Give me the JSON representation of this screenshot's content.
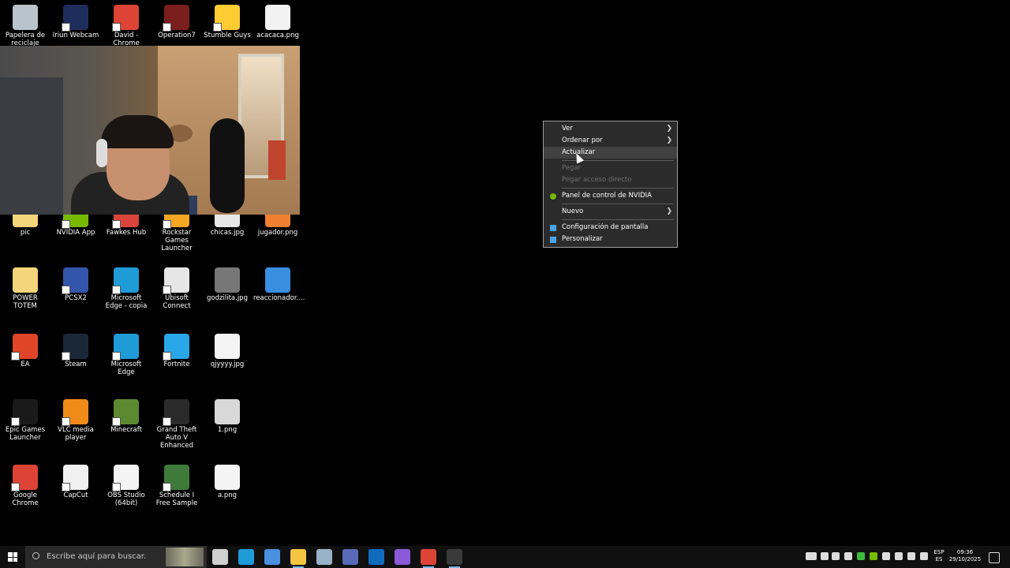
{
  "desktop": {
    "icons": [
      {
        "label": "Papelera de reciclaje",
        "icon": "recycle-bin-icon",
        "color": "#b9c3cc"
      },
      {
        "label": "Iriun Webcam",
        "icon": "iriun-webcam-icon",
        "color": "#1f2d5c"
      },
      {
        "label": "David - Chrome",
        "icon": "chrome-icon",
        "color": "#dd4436"
      },
      {
        "label": "Operation7",
        "icon": "operation7-icon",
        "color": "#7a1e1e"
      },
      {
        "label": "Stumble Guys",
        "icon": "stumble-guys-icon",
        "color": "#ffcc33"
      },
      {
        "label": "acacaca.png",
        "icon": "image-file-icon",
        "color": "#f2f2f2"
      },
      {
        "label": "pic",
        "icon": "folder-icon",
        "color": "#f4d57a"
      },
      {
        "label": "NVIDIA App",
        "icon": "nvidia-icon",
        "color": "#76b900"
      },
      {
        "label": "Fawkes Hub",
        "icon": "fawkes-hub-icon",
        "color": "#d9453a"
      },
      {
        "label": "Rockstar Games Launcher",
        "icon": "rockstar-icon",
        "color": "#f5a623"
      },
      {
        "label": "chicas.jpg",
        "icon": "image-file-icon",
        "color": "#e8e8e8"
      },
      {
        "label": "jugador.png",
        "icon": "image-file-icon",
        "color": "#f08030"
      },
      {
        "label": "POWER TOTEM",
        "icon": "folder-icon",
        "color": "#f4d57a"
      },
      {
        "label": "PCSX2",
        "icon": "pcsx2-icon",
        "color": "#3355aa"
      },
      {
        "label": "Microsoft Edge - copia",
        "icon": "edge-icon",
        "color": "#1f9bd8"
      },
      {
        "label": "Ubisoft Connect",
        "icon": "ubisoft-icon",
        "color": "#e6e6e6"
      },
      {
        "label": "godzilita.jpg",
        "icon": "image-file-icon",
        "color": "#777777"
      },
      {
        "label": "reaccionador....",
        "icon": "image-file-icon",
        "color": "#3a8de0"
      },
      {
        "label": "EA",
        "icon": "ea-icon",
        "color": "#e0452a"
      },
      {
        "label": "Steam",
        "icon": "steam-icon",
        "color": "#1b2838"
      },
      {
        "label": "Microsoft Edge",
        "icon": "edge-icon",
        "color": "#1f9bd8"
      },
      {
        "label": "Fortnite",
        "icon": "fortnite-icon",
        "color": "#2aa7e8"
      },
      {
        "label": "qjyyyy.jpg",
        "icon": "image-file-icon",
        "color": "#f4f4f4"
      },
      {
        "label": "Epic Games Launcher",
        "icon": "epic-games-icon",
        "color": "#1a1a1a"
      },
      {
        "label": "VLC media player",
        "icon": "vlc-icon",
        "color": "#f08a18"
      },
      {
        "label": "Minecraft",
        "icon": "minecraft-icon",
        "color": "#5b8a31"
      },
      {
        "label": "Grand Theft Auto V Enhanced",
        "icon": "gta-icon",
        "color": "#2a2a2a"
      },
      {
        "label": "1.png",
        "icon": "image-file-icon",
        "color": "#d8d8d8"
      },
      {
        "label": "Google Chrome",
        "icon": "chrome-icon",
        "color": "#dd4436"
      },
      {
        "label": "CapCut",
        "icon": "capcut-icon",
        "color": "#f0f0f0"
      },
      {
        "label": "OBS Studio (64bit)",
        "icon": "text-file-icon",
        "color": "#f4f4f4"
      },
      {
        "label": "Schedule I Free Sample",
        "icon": "schedule-i-icon",
        "color": "#3f7a3a"
      },
      {
        "label": "a.png",
        "icon": "image-file-icon",
        "color": "#f4f4f4"
      }
    ]
  },
  "context_menu": {
    "items": [
      {
        "label": "Ver",
        "submenu": true
      },
      {
        "label": "Ordenar por",
        "submenu": true
      },
      {
        "label": "Actualizar",
        "hover": true
      },
      {
        "label": "Pegar",
        "disabled": true
      },
      {
        "label": "Pegar acceso directo",
        "disabled": true
      },
      {
        "label": "Panel de control de NVIDIA",
        "icon": "nvidia-icon",
        "icon_color": "#76b900"
      },
      {
        "label": "Nuevo",
        "submenu": true
      },
      {
        "label": "Configuración de pantalla",
        "icon": "display-icon",
        "icon_color": "#4aa3e8"
      },
      {
        "label": "Personalizar",
        "icon": "personalize-icon",
        "icon_color": "#4aa3e8"
      }
    ]
  },
  "taskbar": {
    "search_placeholder": "Escribe aquí para buscar.",
    "apps": [
      {
        "icon": "task-view-icon",
        "color": "#cfcfcf"
      },
      {
        "icon": "edge-icon",
        "color": "#1f9bd8"
      },
      {
        "icon": "store-icon",
        "color": "#4a8fe0"
      },
      {
        "icon": "file-explorer-icon",
        "color": "#f4c542"
      },
      {
        "icon": "settings-app-icon",
        "color": "#9ab2c8"
      },
      {
        "icon": "quick-assist-icon",
        "color": "#5a6ab8"
      },
      {
        "icon": "outlook-icon",
        "color": "#0f6cbd"
      },
      {
        "icon": "copilot-icon",
        "color": "#8a5ad8"
      },
      {
        "icon": "chrome-icon",
        "color": "#dd4436"
      },
      {
        "icon": "obs-icon",
        "color": "#3a3a3a"
      }
    ],
    "tray": {
      "icons": [
        {
          "icon": "keyboard-icon",
          "color": "#dcdcdc"
        },
        {
          "icon": "ubisoft-tray-icon",
          "color": "#dcdcdc"
        },
        {
          "icon": "iriun-tray-icon",
          "color": "#dcdcdc"
        },
        {
          "icon": "microphone-icon",
          "color": "#dcdcdc"
        },
        {
          "icon": "xbox-icon",
          "color": "#3dbb3d"
        },
        {
          "icon": "nvidia-tray-icon",
          "color": "#76b900"
        },
        {
          "icon": "network-icon",
          "color": "#dcdcdc"
        },
        {
          "icon": "discord-icon",
          "color": "#dcdcdc"
        },
        {
          "icon": "volume-icon",
          "color": "#dcdcdc"
        },
        {
          "icon": "wifi-icon",
          "color": "#dcdcdc"
        }
      ],
      "language": "ESP",
      "keyboard": "ES",
      "time": "09:36",
      "date": "29/10/2025"
    }
  }
}
